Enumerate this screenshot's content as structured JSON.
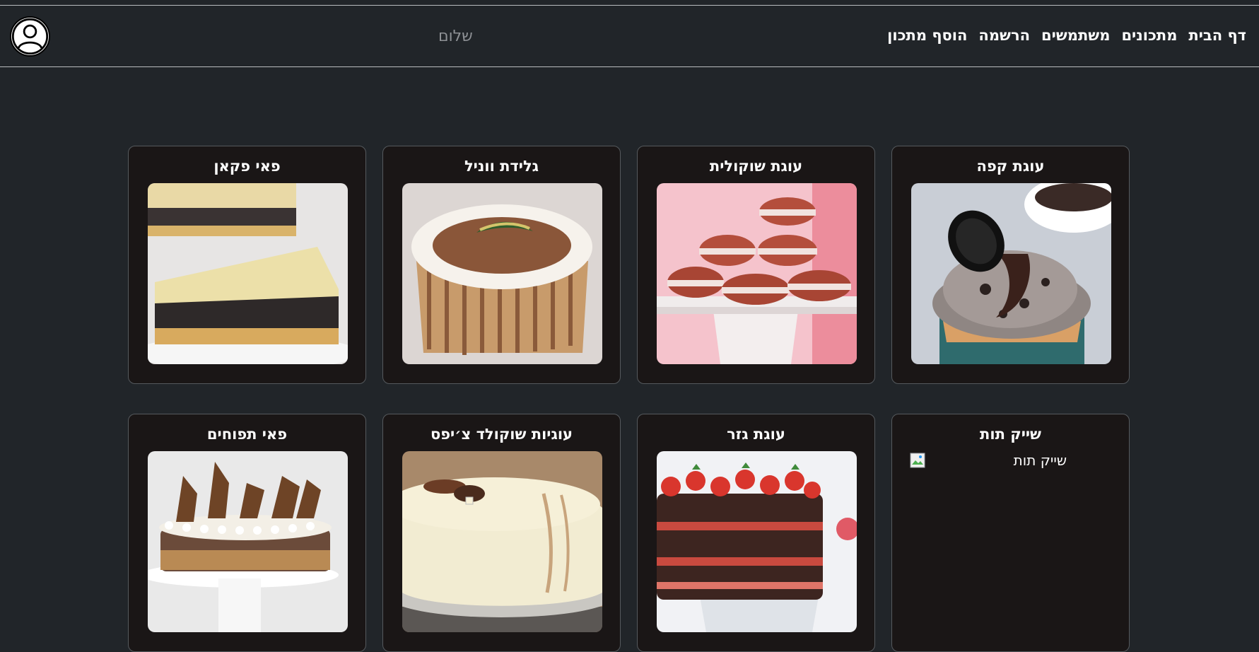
{
  "nav": {
    "items": [
      "דף הבית",
      "מתכונים",
      "משתמשים",
      "הרשמה",
      "הוסף מתכון"
    ],
    "greeting": "שלום",
    "avatar_icon": "user-circle-icon"
  },
  "recipes": [
    {
      "title": "עוגת קפה",
      "image": "oreo-cupcake"
    },
    {
      "title": "עוגת שוקולית",
      "image": "chocolate-macarons"
    },
    {
      "title": "גלידת ווניל",
      "image": "wafer-rolled-cake"
    },
    {
      "title": "פאי פקאן",
      "image": "poppy-seed-cheesecake"
    },
    {
      "title": "שייק תות",
      "image": "broken-image",
      "alt": "שייק תות"
    },
    {
      "title": "עוגת גזר",
      "image": "strawberry-layer-cake"
    },
    {
      "title": "עוגיות שוקולד צ׳יפס",
      "image": "white-chocolate-cake"
    },
    {
      "title": "פאי תפוחים",
      "image": "nut-crunch-cake"
    }
  ],
  "colors": {
    "background": "#212529",
    "card_background": "#1a1616",
    "nav_text": "#ffffff",
    "greeting_text": "#8e9195"
  }
}
